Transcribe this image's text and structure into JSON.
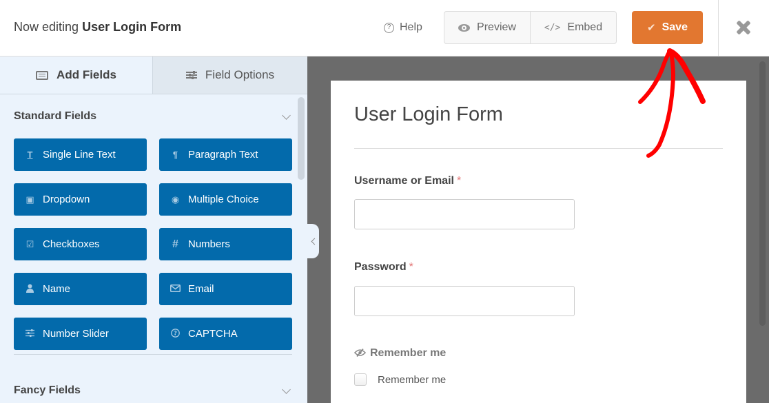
{
  "header": {
    "title_prefix": "Now editing",
    "form_name": "User Login Form",
    "help_label": "Help",
    "preview_label": "Preview",
    "embed_label": "Embed",
    "save_label": "Save",
    "save_color": "#e27730"
  },
  "sidebar": {
    "tabs": [
      {
        "label": "Add Fields",
        "active": true
      },
      {
        "label": "Field Options",
        "active": false
      }
    ],
    "sections": [
      {
        "title": "Standard Fields",
        "expanded": true
      },
      {
        "title": "Fancy Fields",
        "expanded": false
      }
    ],
    "standard_fields": [
      {
        "label": "Single Line Text",
        "icon": "text-cursor-icon",
        "glyph": "T"
      },
      {
        "label": "Paragraph Text",
        "icon": "pilcrow-icon",
        "glyph": "¶"
      },
      {
        "label": "Dropdown",
        "icon": "dropdown-icon",
        "glyph": "▣"
      },
      {
        "label": "Multiple Choice",
        "icon": "radio-icon",
        "glyph": "◉"
      },
      {
        "label": "Checkboxes",
        "icon": "checkbox-icon",
        "glyph": "☑"
      },
      {
        "label": "Numbers",
        "icon": "hash-icon",
        "glyph": "#"
      },
      {
        "label": "Name",
        "icon": "user-icon",
        "glyph": "👤"
      },
      {
        "label": "Email",
        "icon": "envelope-icon",
        "glyph": "✉"
      },
      {
        "label": "Number Slider",
        "icon": "sliders-icon",
        "glyph": "☰"
      },
      {
        "label": "CAPTCHA",
        "icon": "question-circle-icon",
        "glyph": "?"
      }
    ],
    "field_button_color": "#036aab"
  },
  "form": {
    "title": "User Login Form",
    "fields": [
      {
        "label": "Username or Email",
        "required": true,
        "value": ""
      },
      {
        "label": "Password",
        "required": true,
        "value": ""
      }
    ],
    "remember": {
      "hidden_label": "Remember me",
      "checkbox_label": "Remember me",
      "checked": false
    }
  },
  "annotation": {
    "type": "red-arrow",
    "points_to": "save-button",
    "color": "#ff0000"
  }
}
